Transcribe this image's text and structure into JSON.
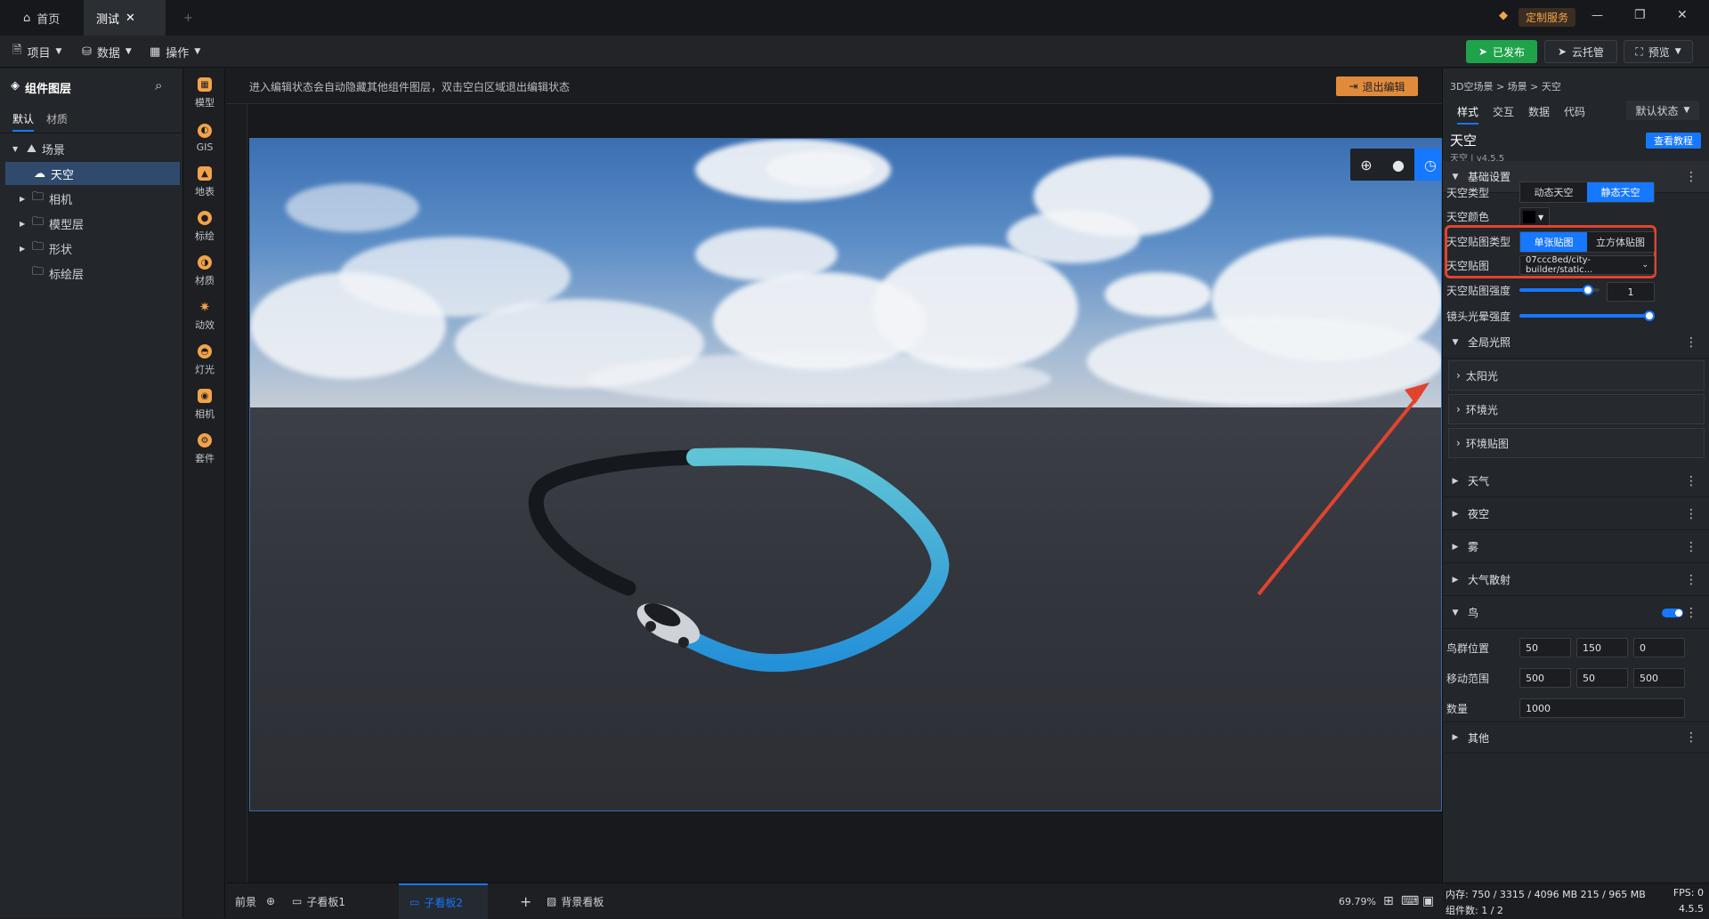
{
  "tabs": {
    "home": "首页",
    "test": "测试",
    "add": "+"
  },
  "titlebar": {
    "custom_service": "定制服务",
    "minimize": "—",
    "maximize": "❐",
    "close": "✕"
  },
  "menu": {
    "project": "项目",
    "data": "数据",
    "operate": "操作"
  },
  "actions": {
    "published": "已发布",
    "cloud": "云托管",
    "preview": "预览"
  },
  "left": {
    "title": "组件图层",
    "tabs": [
      "默认",
      "材质"
    ],
    "tree": [
      {
        "label": "场景",
        "icon": "scene-icon"
      },
      {
        "label": "天空",
        "icon": "sky-icon"
      },
      {
        "label": "相机",
        "icon": "folder-icon"
      },
      {
        "label": "模型层",
        "icon": "folder-icon"
      },
      {
        "label": "形状",
        "icon": "folder-icon"
      },
      {
        "label": "标绘层",
        "icon": "folder-icon"
      }
    ]
  },
  "tools": [
    "模型",
    "GIS",
    "地表",
    "标绘",
    "材质",
    "动效",
    "灯光",
    "相机",
    "套件"
  ],
  "canvas": {
    "hint": "进入编辑状态会自动隐藏其他组件图层，双击空白区域退出编辑状态",
    "exit_edit": "退出编辑"
  },
  "bottom": {
    "front": "前景",
    "sub1": "子看板1",
    "sub2": "子看板2",
    "add": "+",
    "bg": "背景看板",
    "zoom": "69.79%"
  },
  "right": {
    "breadcrumb": "3D空场景 > 场景 > 天空",
    "tabs": [
      "样式",
      "交互",
      "数据",
      "代码"
    ],
    "state": "默认状态",
    "comp_name": "天空",
    "comp_version": "天空 | v4.5.5",
    "tutorial": "查看教程",
    "basic": "基础设置",
    "sky_type_label": "天空类型",
    "sky_type_opts": [
      "动态天空",
      "静态天空"
    ],
    "sky_color_label": "天空颜色",
    "tex_type_label": "天空贴图类型",
    "tex_type_opts": [
      "单张贴图",
      "立方体贴图"
    ],
    "tex_label": "天空贴图",
    "tex_value": "07ccc8ed/city-builder/static...",
    "tex_strength_label": "天空贴图强度",
    "tex_strength_value": "1",
    "tex_strength_level": 0.85,
    "lens_label": "镜头光晕强度",
    "lens_level": 1.0,
    "global_light": "全局光照",
    "sun": "太阳光",
    "ambient": "环境光",
    "env_map": "环境贴图",
    "weather": "天气",
    "night": "夜空",
    "fog": "雾",
    "atmosphere": "大气散射",
    "bird": "鸟",
    "bird_pos_label": "鸟群位置",
    "bird_pos": [
      "50",
      "150",
      "0"
    ],
    "move_label": "移动范围",
    "move": [
      "500",
      "50",
      "500"
    ],
    "count_label": "数量",
    "count": "1000",
    "other": "其他"
  },
  "status": {
    "mem": "内存: 750 / 3315 / 4096 MB  215 / 965 MB",
    "fps": "FPS: 0",
    "count": "组件数: 1 / 2",
    "ver": "4.5.5"
  },
  "colors": {
    "accent": "#1677ff",
    "highlight": "#e0442e",
    "publish": "#1fa34a",
    "exit": "#e08a3c"
  }
}
